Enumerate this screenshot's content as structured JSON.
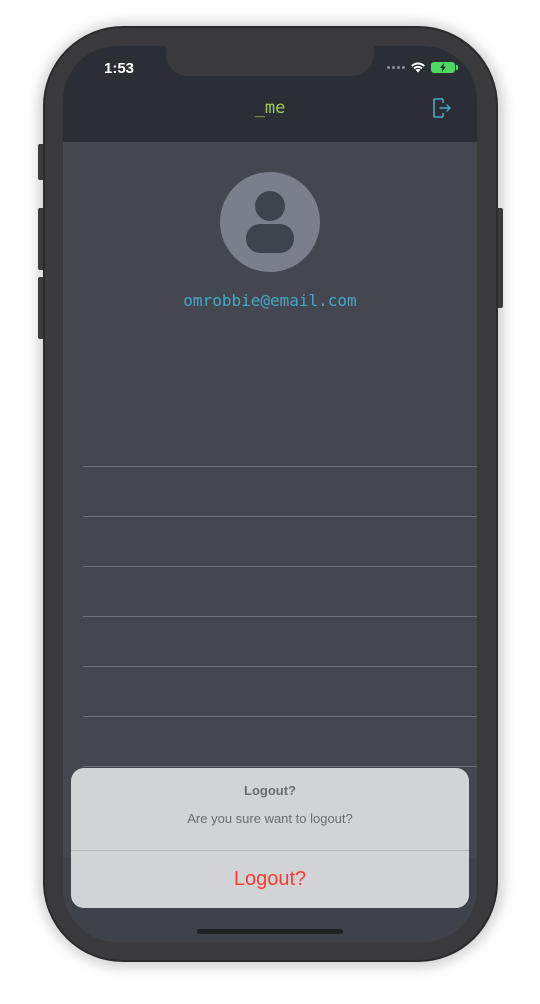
{
  "status_bar": {
    "time": "1:53"
  },
  "nav": {
    "title": "_me",
    "logout_icon": "logout-icon"
  },
  "profile": {
    "email": "omrobbie@email.com",
    "avatar_icon": "person-icon"
  },
  "list": {
    "row_count": 7
  },
  "alert": {
    "title": "Logout?",
    "message": "Are you sure want to logout?",
    "action_label": "Logout?"
  },
  "colors": {
    "nav_bg": "#2b2e35",
    "screen_bg": "#444750",
    "title_green": "#9acd52",
    "accent_blue": "#46a7c9",
    "destructive_red": "#ff3b30",
    "battery_green": "#4cd964"
  }
}
